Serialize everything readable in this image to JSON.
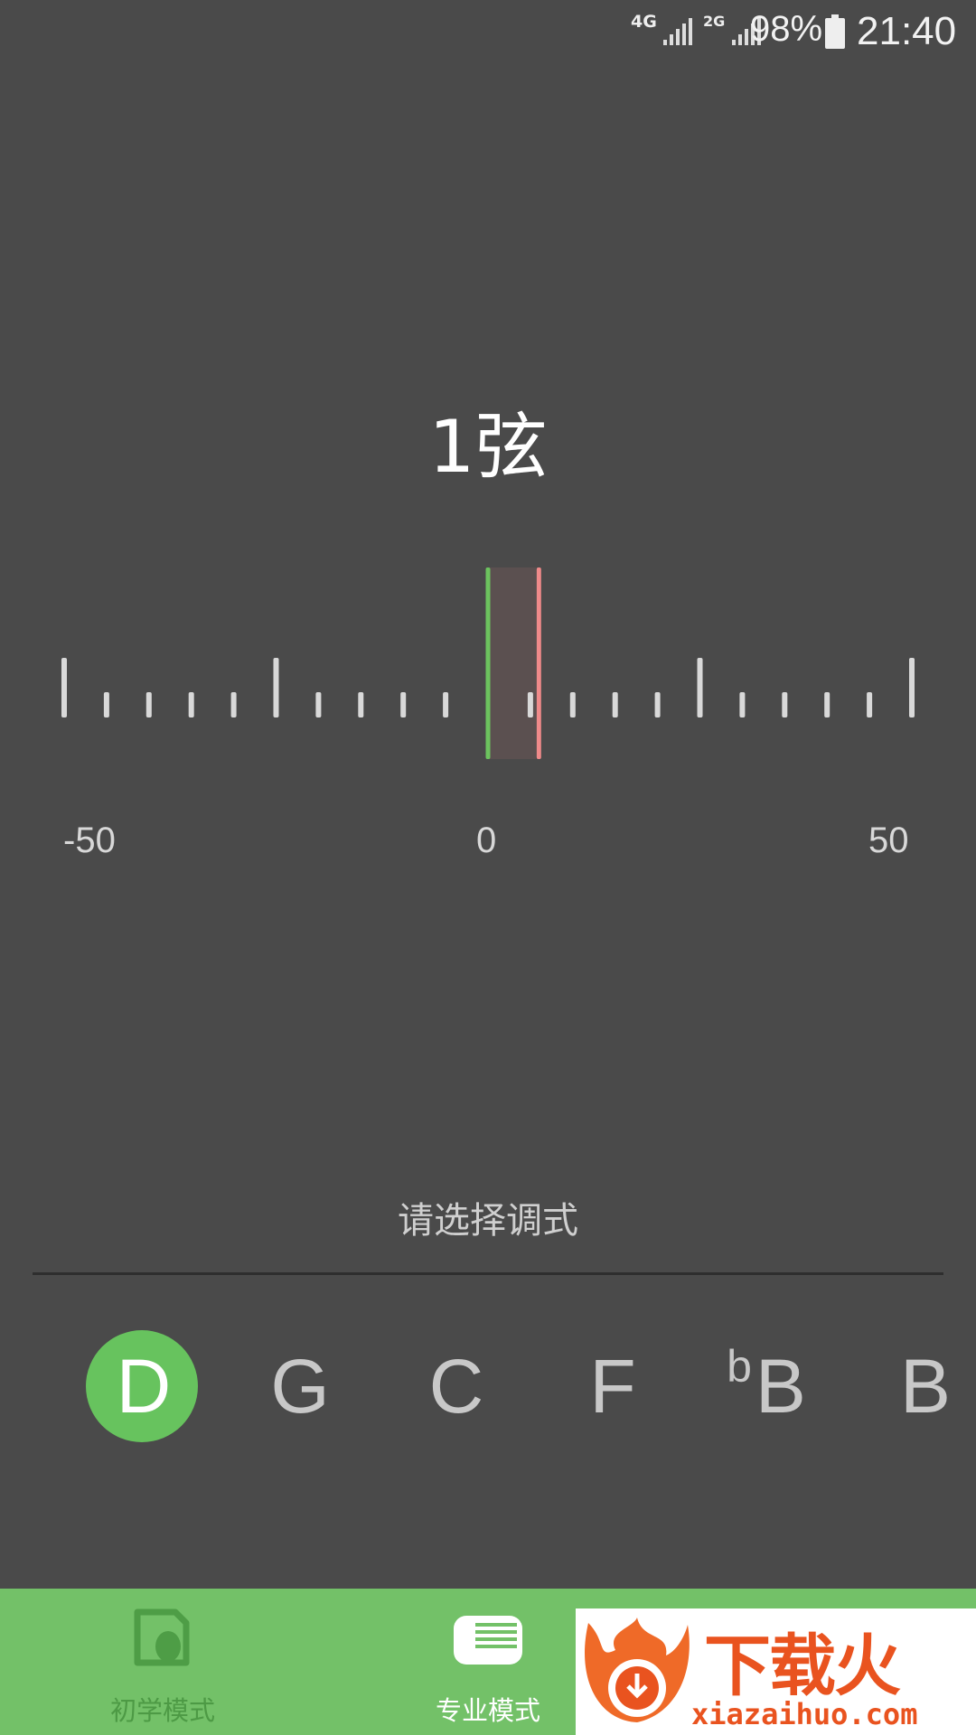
{
  "status_bar": {
    "network_1": "4G",
    "network_2": "2G",
    "battery": "98%",
    "time": "21:40"
  },
  "tuner": {
    "string_label": "1弦",
    "scale_min": "-50",
    "scale_center": "0",
    "scale_max": "50",
    "needle_cents": 6,
    "colors": {
      "target": "#6cc35e",
      "needle": "#f08a8a"
    }
  },
  "mode_select": {
    "prompt": "请选择调式",
    "keys": [
      {
        "label": "D",
        "flat": "",
        "selected": true
      },
      {
        "label": "G",
        "flat": "",
        "selected": false
      },
      {
        "label": "C",
        "flat": "",
        "selected": false
      },
      {
        "label": "F",
        "flat": "",
        "selected": false
      },
      {
        "label": "B",
        "flat": "b",
        "selected": false
      },
      {
        "label": "B",
        "flat": "",
        "selected": false
      }
    ]
  },
  "bottom_nav": {
    "items": [
      {
        "label": "初学模式",
        "icon": "beginner-mode-icon",
        "active": false
      },
      {
        "label": "专业模式",
        "icon": "pro-mode-icon",
        "active": true
      }
    ]
  },
  "watermark": {
    "brand": "下载火",
    "url": "xiazaihuo.com"
  }
}
